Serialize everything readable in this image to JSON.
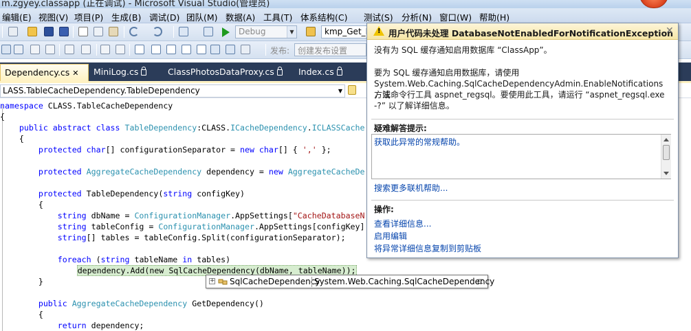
{
  "window": {
    "title": "m.zgyey.classapp (正在调试) - Microsoft Visual Studio(管理员)"
  },
  "menu": [
    "编辑(E)",
    "视图(V)",
    "项目(P)",
    "生成(B)",
    "调试(D)",
    "团队(M)",
    "数据(A)",
    "工具(T)",
    "体系结构(C)",
    "测试(S)",
    "分析(N)",
    "窗口(W)",
    "帮助(H)"
  ],
  "toolbar": {
    "config": "Debug",
    "find": "kmp_Get_K",
    "publish_label": "发布:",
    "publish_placeholder": "创建发布设置"
  },
  "tabs": [
    {
      "label": "Dependency.cs",
      "active": true
    },
    {
      "label": "MiniLog.cs",
      "active": false
    },
    {
      "label": "ClassPhotosDataProxy.cs",
      "active": false
    },
    {
      "label": "Index.cs",
      "active": false
    }
  ],
  "nav": {
    "type_combo": "LASS.TableCacheDependency.TableDependency"
  },
  "code": {
    "l1a": "namespace",
    "l1b": " CLASS.TableCacheDependency",
    "l2": "{",
    "l3a": "    public abstract class ",
    "l3b": "TableDependency",
    "l3c": ":CLASS.",
    "l3d": "ICacheDependency",
    "l3e": ".",
    "l3f": "ICLASSCache",
    "l4": "    {",
    "l5a": "        protected char",
    "l5b": "[] configurationSeparator = ",
    "l5c": "new char",
    "l5d": "[] { ",
    "l5e": "','",
    "l5f": " };",
    "l6a": "        protected ",
    "l6b": "AggregateCacheDependency",
    "l6c": " dependency = ",
    "l6d": "new ",
    "l6e": "AggregateCacheDe",
    "l7a": "        protected ",
    "l7b": "TableDependency(",
    "l7c": "string",
    "l7d": " configKey)",
    "l8": "        {",
    "l9a": "            string",
    "l9b": " dbName = ",
    "l9c": "ConfigurationManager",
    "l9d": ".AppSettings[",
    "l9e": "\"CacheDatabaseN",
    "l10a": "            string",
    "l10b": " tableConfig = ",
    "l10c": "ConfigurationManager",
    "l10d": ".AppSettings[configKey]",
    "l11a": "            string",
    "l11b": "[] tables = tableConfig.Split(configurationSeparator);",
    "l12a": "            foreach",
    "l12b": " (",
    "l12c": "string",
    "l12d": " tableName ",
    "l12e": "in",
    "l12f": " tables)",
    "l13a": "                ",
    "l13b": "dependency.Add(",
    "l13c": "new ",
    "l13d": "SqlCacheDependency",
    "l13e": "(dbName, tableName));",
    "l14": "        }",
    "l15a": "        public ",
    "l15b": "AggregateCacheDependency",
    "l15c": " GetDependency()",
    "l16": "        {",
    "l17a": "            return",
    "l17b": " dependency;"
  },
  "quickinfo": {
    "short": "SqlCacheDependency",
    "full": "System.Web.Caching.SqlCacheDependency"
  },
  "exception": {
    "title": "用户代码未处理 DatabaseNotEnabledForNotificationException",
    "message": "没有为 SQL 缓存通知启用数据库 “ClassApp”。",
    "detail_1": "要为 SQL 缓存通知启用数据库，请使用",
    "detail_2": "System.Web.Caching.SqlCacheDependencyAdmin.EnableNotifications 方法",
    "detail_3": "，或命令行工具 aspnet_regsql。要使用此工具，请运行 “aspnet_regsql.exe",
    "detail_4": "-?” 以了解详细信息。",
    "hints_header": "疑难解答提示:",
    "hint_item": "获取此异常的常规帮助。",
    "search_link": "搜索更多联机帮助...",
    "actions_header": "操作:",
    "actions": [
      "查看详细信息...",
      "启用编辑",
      "将异常详细信息复制到剪贴板"
    ]
  },
  "colors": {
    "keyword": "#0000ff",
    "type": "#2b91af",
    "string": "#a31515",
    "tab_strip": "#2b3c59",
    "warning": "#f0c400",
    "link": "#0645ad"
  }
}
